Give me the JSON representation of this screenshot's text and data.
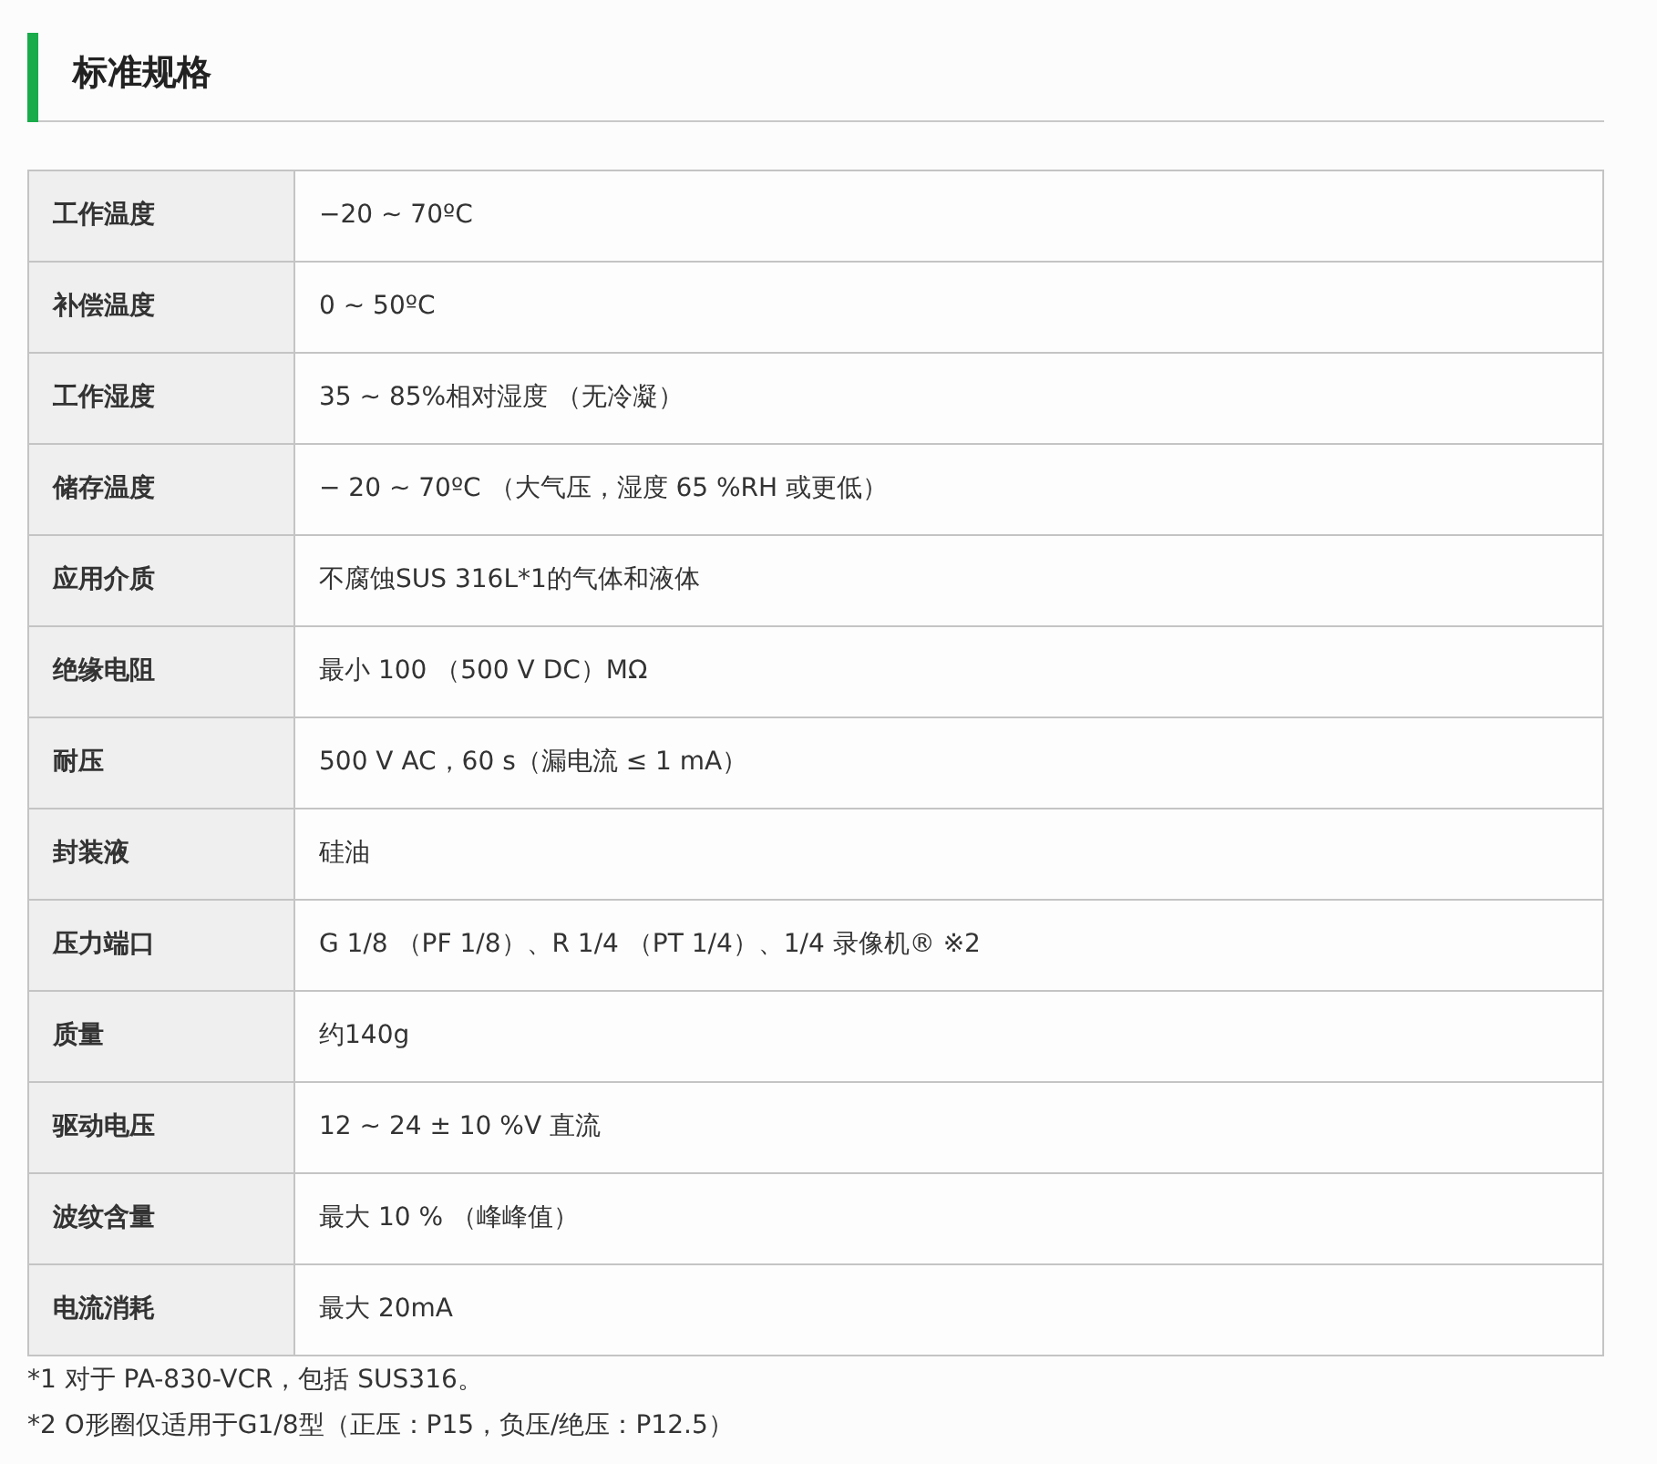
{
  "heading": "标准规格",
  "table": {
    "rows": [
      {
        "label": "工作温度",
        "value": "−20 ~ 70ºC"
      },
      {
        "label": "补偿温度",
        "value": "0 ~ 50ºC"
      },
      {
        "label": "工作湿度",
        "value": "35 ~ 85%相对湿度 （无冷凝）"
      },
      {
        "label": "储存温度",
        "value": "− 20 ~ 70ºC （大气压，湿度 65 %RH 或更低）"
      },
      {
        "label": "应用介质",
        "value": "不腐蚀SUS 316L*1的气体和液体"
      },
      {
        "label": "绝缘电阻",
        "value": "最小 100 （500 V DC）MΩ"
      },
      {
        "label": "耐压",
        "value": "500 V AC，60 s（漏电流 ≤ 1 mA）"
      },
      {
        "label": "封装液",
        "value": "硅油"
      },
      {
        "label": "压力端口",
        "value": "G 1/8 （PF 1/8）、R 1/4 （PT 1/4）、1/4 录像机® ※2"
      },
      {
        "label": "质量",
        "value": "约140g"
      },
      {
        "label": "驱动电压",
        "value": "12 ~ 24 ± 10 %V 直流"
      },
      {
        "label": "波纹含量",
        "value": "最大 10 % （峰峰值）"
      },
      {
        "label": "电流消耗",
        "value": "最大 20mA"
      }
    ]
  },
  "footnotes": [
    "*1 对于 PA-830-VCR，包括 SUS316。",
    "*2 O形圈仅适用于G1/8型（正压：P15，负压/绝压：P12.5）"
  ]
}
